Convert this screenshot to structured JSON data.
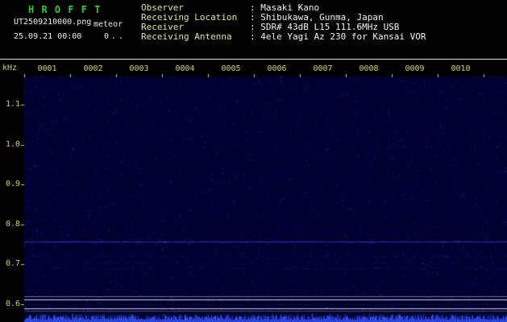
{
  "header": {
    "app_title": "H R O F F T",
    "filename": "UT2509210000.png",
    "station_label": "meteor",
    "datetime": "25.09.21 00:00",
    "counter": "0..",
    "info": [
      {
        "label": "Observer",
        "value": ": Masaki Kano"
      },
      {
        "label": "Receiving Location",
        "value": ": Shibukawa, Gunma, Japan"
      },
      {
        "label": "Receiver",
        "value": ": SDR# 43dB L15 111.6MHz USB"
      },
      {
        "label": "Receiving Antenna",
        "value": ": 4ele Yagi Az 230 for Kansai VOR"
      }
    ]
  },
  "chart_data": {
    "type": "heatmap",
    "title": "HROFFT 10-minute radio meteor echo spectrogram starting 25.09.21 00:00 UT",
    "x_axis": {
      "unit": "minute",
      "tick_labels": [
        "0001",
        "0002",
        "0003",
        "0004",
        "0005",
        "0006",
        "0007",
        "0008",
        "0009",
        "0010"
      ]
    },
    "y_axis": {
      "label": "kHz",
      "tick_labels": [
        "1.1",
        "1.0",
        "0.9",
        "0.8",
        "0.7",
        "0.6"
      ],
      "tick_khz": [
        1.1,
        1.0,
        0.9,
        0.8,
        0.7,
        0.6
      ],
      "range_khz": [
        0.556,
        1.17
      ]
    },
    "legend": "none",
    "series_features": {
      "background": "uniform dark-blue receiver noise floor, no meteor echoes visible",
      "carrier_line_khz": 0.757,
      "faint_interference_lines_khz": [
        0.72,
        0.705,
        0.69
      ],
      "white_reference_lines": [
        {
          "khz": 0.62,
          "alpha": 0.5
        },
        {
          "khz": 0.612,
          "alpha": 0.95
        },
        {
          "khz": 0.59,
          "alpha": 0.9
        },
        {
          "khz": 0.584,
          "alpha": 0.35
        }
      ],
      "signal_level_band": "continuous dense blue noise trace along bottom edge"
    },
    "colors": {
      "plot_bg": "#000030",
      "noise_dim": "#000041",
      "noise_bright": "#232ea6",
      "carrier": "#2d46d7",
      "reference_white": "#e1e1e1",
      "axis_text": "#d2d25a",
      "title_green": "#33cc33",
      "header_label_yellow": "#e3e39a",
      "header_value_white": "#f5f5f5",
      "band_blue": "#2638d8"
    }
  }
}
